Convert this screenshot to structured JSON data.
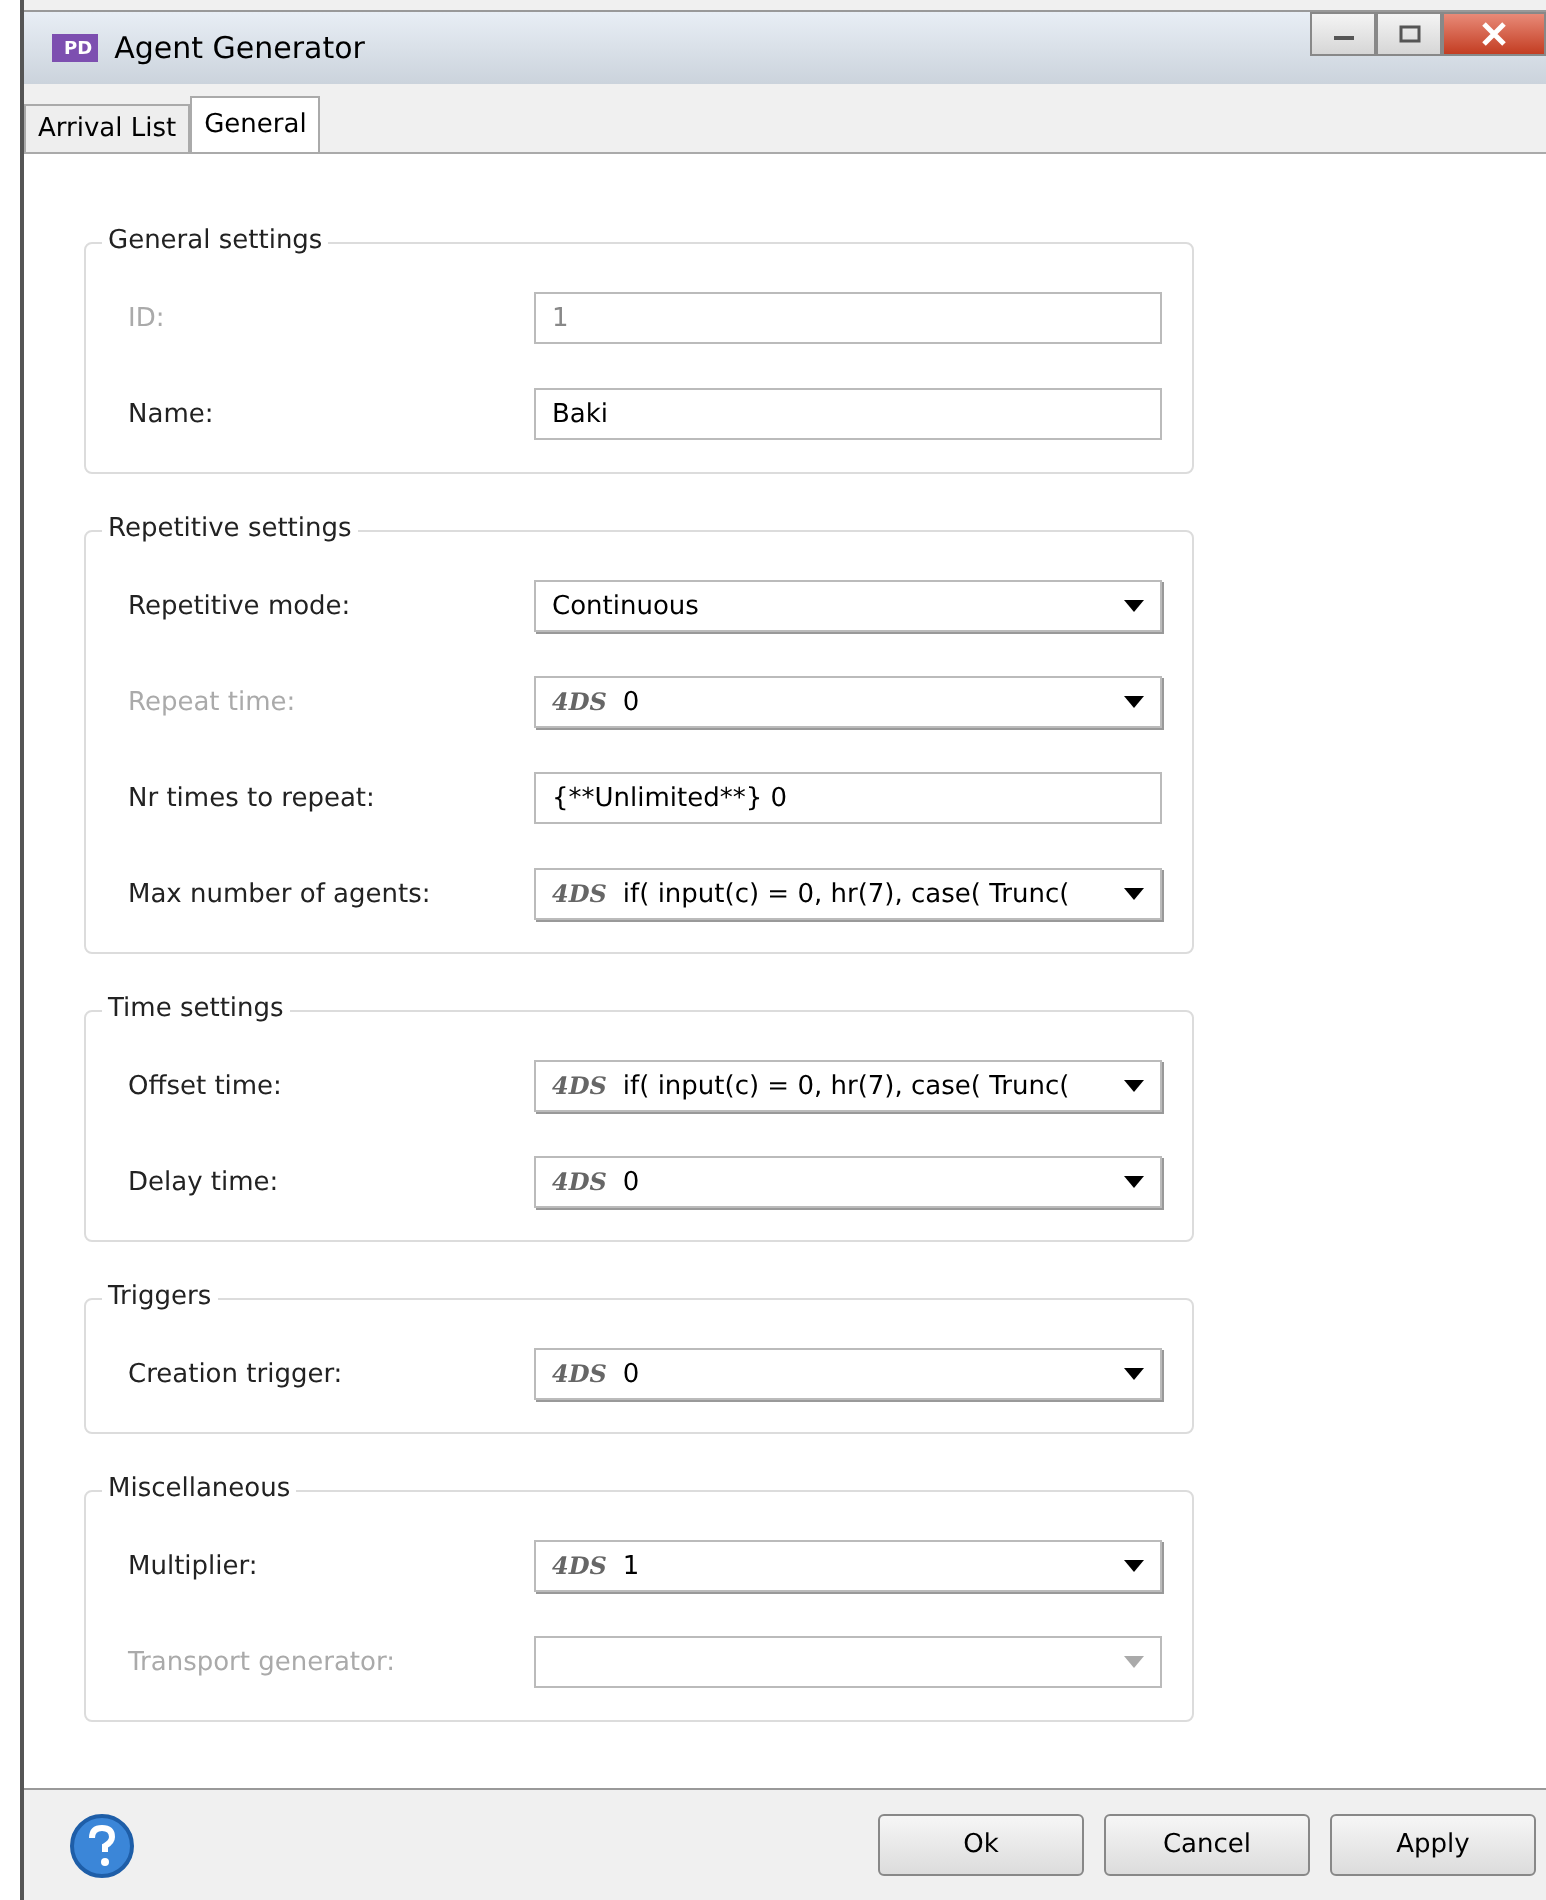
{
  "window": {
    "title": "Agent Generator",
    "app_icon": "PD"
  },
  "tabs": [
    {
      "label": "Arrival List",
      "selected": false
    },
    {
      "label": "General",
      "selected": true
    }
  ],
  "groups": [
    {
      "title": "General settings",
      "fields": [
        {
          "label": "ID:",
          "kind": "text",
          "value": "1",
          "disabled": true
        },
        {
          "label": "Name:",
          "kind": "text",
          "value": "Baki",
          "disabled": false
        }
      ]
    },
    {
      "title": "Repetitive settings",
      "fields": [
        {
          "label": "Repetitive mode:",
          "kind": "dropdown",
          "value": "Continuous",
          "disabled": false
        },
        {
          "label": "Repeat time:",
          "kind": "expression",
          "prefix": "4DS",
          "value": "0",
          "disabled": true
        },
        {
          "label": "Nr times to repeat:",
          "kind": "text",
          "value": "{**Unlimited**} 0",
          "disabled": false
        },
        {
          "label": "Max number of agents:",
          "kind": "expression",
          "prefix": "4DS",
          "value": "if( input(c) = 0, hr(7), case(  Trunc(",
          "disabled": false
        }
      ]
    },
    {
      "title": "Time settings",
      "fields": [
        {
          "label": "Offset time:",
          "kind": "expression",
          "prefix": "4DS",
          "value": "if( input(c) = 0, hr(7), case(  Trunc(",
          "disabled": false
        },
        {
          "label": "Delay time:",
          "kind": "expression",
          "prefix": "4DS",
          "value": "0",
          "disabled": false
        }
      ]
    },
    {
      "title": "Triggers",
      "fields": [
        {
          "label": "Creation trigger:",
          "kind": "expression",
          "prefix": "4DS",
          "value": "0",
          "disabled": false
        }
      ]
    },
    {
      "title": "Miscellaneous",
      "fields": [
        {
          "label": "Multiplier:",
          "kind": "expression",
          "prefix": "4DS",
          "value": "1",
          "disabled": false
        },
        {
          "label": "Transport generator:",
          "kind": "dropdown",
          "disabled": true
        }
      ]
    }
  ],
  "buttons": [
    "Ok",
    "Cancel",
    "Apply"
  ]
}
